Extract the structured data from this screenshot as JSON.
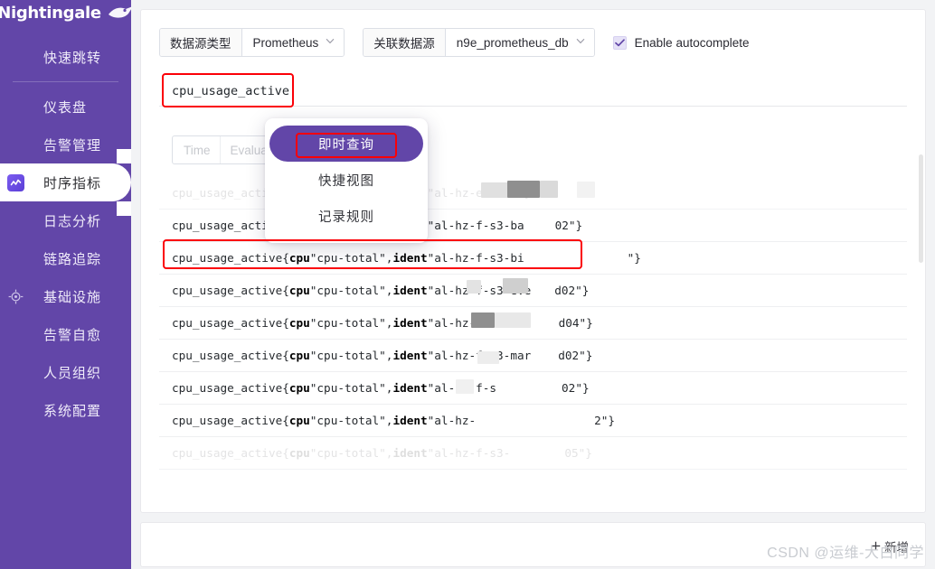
{
  "brand": {
    "name": "Nightingale",
    "logo_icon": "bird-icon"
  },
  "sidebar": {
    "bg_color": "#6246A8",
    "items": [
      {
        "label": "快速跳转",
        "icon": null,
        "active": false
      },
      {
        "label": "仪表盘",
        "icon": null,
        "active": false
      },
      {
        "label": "告警管理",
        "icon": null,
        "active": false
      },
      {
        "label": "时序指标",
        "icon": "line-chart-icon",
        "active": true
      },
      {
        "label": "日志分析",
        "icon": null,
        "active": false
      },
      {
        "label": "链路追踪",
        "icon": null,
        "active": false
      },
      {
        "label": "基础设施",
        "icon": "target-icon",
        "active": false
      },
      {
        "label": "告警自愈",
        "icon": null,
        "active": false
      },
      {
        "label": "人员组织",
        "icon": null,
        "active": false
      },
      {
        "label": "系统配置",
        "icon": null,
        "active": false
      }
    ]
  },
  "toolbar": {
    "datasource_type": {
      "label": "数据源类型",
      "value": "Prometheus"
    },
    "datasource_link": {
      "label": "关联数据源",
      "value": "n9e_prometheus_db"
    },
    "autocomplete": {
      "label": "Enable autocomplete",
      "checked": true
    }
  },
  "query": {
    "value": "cpu_usage_active",
    "placeholder": "",
    "highlighted": true
  },
  "time_field": {
    "label": "Time",
    "placeholder": "Evaluation time",
    "icon": "calendar-icon"
  },
  "dropdown": {
    "items": [
      {
        "label": "即时查询",
        "selected": true,
        "highlighted": true
      },
      {
        "label": "快捷视图",
        "selected": false,
        "highlighted": false
      },
      {
        "label": "记录规则",
        "selected": false,
        "highlighted": false
      }
    ]
  },
  "results": [
    {
      "prefix": "cpu_usage_active{",
      "k1": "cpu",
      "v1": "\"cpu-total\", ",
      "k2": "ident",
      "v2": "\"al-hz-e-sa",
      "tail": "01\"}",
      "faded": true,
      "highlighted": false
    },
    {
      "prefix": "cpu_usage_active{",
      "k1": "cpu",
      "v1": "\"cpu-total\", ",
      "k2": "ident",
      "v2": "\"al-hz-f-s3-ba",
      "tail": "02\"}",
      "faded": false,
      "highlighted": false
    },
    {
      "prefix": "cpu_usage_active{",
      "k1": "cpu",
      "v1": "\"cpu-total\", ",
      "k2": "ident",
      "v2": "\"al-hz-f-s3-bi",
      "tail": "\"}",
      "faded": false,
      "highlighted": true
    },
    {
      "prefix": "cpu_usage_active{",
      "k1": "cpu",
      "v1": "\"cpu-total\", ",
      "k2": "ident",
      "v2": "\"al-hz-f-s3-eve",
      "tail": "d02\"}",
      "faded": false,
      "highlighted": false
    },
    {
      "prefix": "cpu_usage_active{",
      "k1": "cpu",
      "v1": "\"cpu-total\", ",
      "k2": "ident",
      "v2": "\"al-hz-f-s3-ev",
      "tail": "d04\"}",
      "faded": false,
      "highlighted": false
    },
    {
      "prefix": "cpu_usage_active{",
      "k1": "cpu",
      "v1": "\"cpu-total\", ",
      "k2": "ident",
      "v2": "\"al-hz-f-s3-mar",
      "tail": "d02\"}",
      "faded": false,
      "highlighted": false
    },
    {
      "prefix": "cpu_usage_active{",
      "k1": "cpu",
      "v1": "\"cpu-total\", ",
      "k2": "ident",
      "v2": "\"al-hz-f-s",
      "tail": "02\"}",
      "faded": false,
      "highlighted": false
    },
    {
      "prefix": "cpu_usage_active{",
      "k1": "cpu",
      "v1": "\"cpu-total\", ",
      "k2": "ident",
      "v2": "\"al-hz-",
      "tail": "2\"}",
      "faded": false,
      "highlighted": false
    },
    {
      "prefix": "cpu_usage_active{",
      "k1": "cpu",
      "v1": "\"cpu-total\", ",
      "k2": "ident",
      "v2": "\"al-hz-f-s3-",
      "tail": "05\"}",
      "faded": true,
      "highlighted": false
    }
  ],
  "bottom": {
    "add_button_label": "新增",
    "add_button_icon": "plus-icon"
  },
  "watermark": {
    "text": "CSDN @运维-大白同学"
  },
  "colors": {
    "brand_purple": "#6246A8",
    "highlight_red": "#fb0007",
    "panel_bg": "#ffffff",
    "page_bg": "#f2f3f5"
  }
}
